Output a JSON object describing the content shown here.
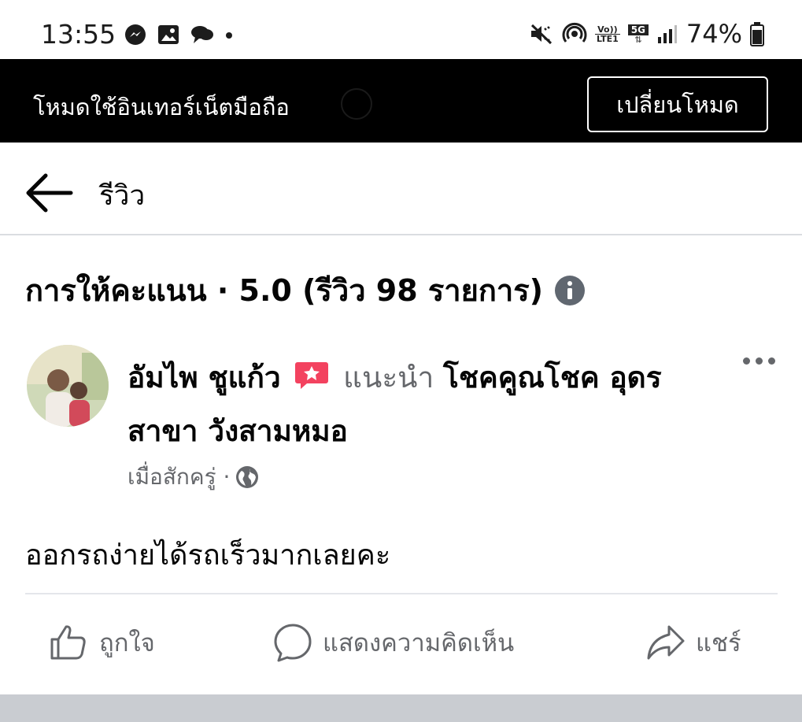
{
  "status_bar": {
    "time": "13:55",
    "battery": "74%",
    "left_icons": [
      "messenger-icon",
      "gallery-icon",
      "chat-bubbles-icon",
      "dot-icon"
    ],
    "right_icons": [
      "mute-vibrate-icon",
      "hotspot-icon",
      "volte-icon",
      "5g-icon",
      "signal-icon",
      "battery-icon"
    ],
    "volte_top": "Vo))",
    "volte_bottom": "LTE1",
    "network_badge": "5G"
  },
  "data_mode_banner": {
    "text": "โหมดใช้อินเทอร์เน็ตมือถือ",
    "switch_button_label": "เปลี่ยนโหมด"
  },
  "header": {
    "title": "รีวิว"
  },
  "rating": {
    "label": "การให้คะแนน · 5.0 (รีวิว 98 รายการ)"
  },
  "review": {
    "author": "อัมไพ ชูแก้ว",
    "recommends": "แนะนำ",
    "page_name": "โชคคูณโชค อุดร สาขา วังสามหมอ",
    "time": "เมื่อสักครู่ ·",
    "text": "ออกรถง่ายได้รถเร็วมากเลยคะ"
  },
  "actions": {
    "like": "ถูกใจ",
    "comment": "แสดงความคิดเห็น",
    "share": "แชร์"
  },
  "colors": {
    "banner_bg": "#000000",
    "secondary_text": "#65676b",
    "recommend_red": "#f3425f",
    "divider": "#e4e6eb"
  }
}
